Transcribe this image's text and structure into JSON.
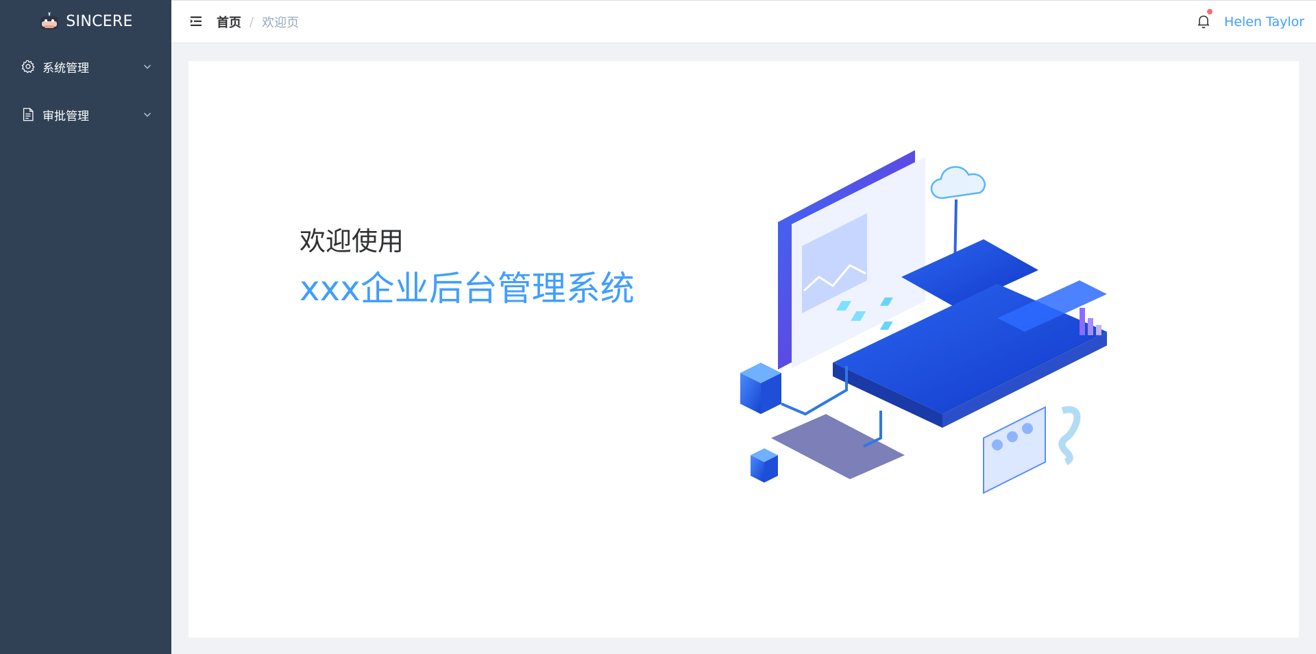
{
  "app": {
    "logo_text": "SINCERE"
  },
  "sidebar": {
    "items": [
      {
        "label": "系统管理",
        "icon": "gear-icon"
      },
      {
        "label": "审批管理",
        "icon": "document-icon"
      }
    ]
  },
  "header": {
    "breadcrumb": {
      "home": "首页",
      "separator": "/",
      "current": "欢迎页"
    },
    "user_name": "Helen Taylor"
  },
  "main": {
    "welcome_line1": "欢迎使用",
    "welcome_line2": "xxx企业后台管理系统"
  },
  "colors": {
    "sidebar_bg": "#304156",
    "accent": "#409eff",
    "notification_dot": "#f56c6c",
    "page_bg": "#f0f2f5"
  }
}
